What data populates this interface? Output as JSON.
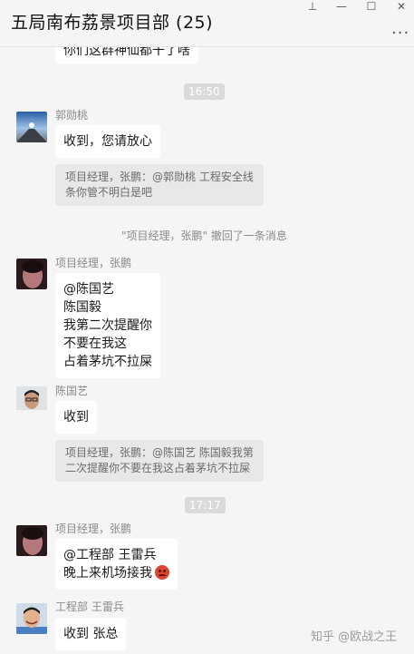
{
  "window": {
    "title": "五局南布荔景项目部 (25)",
    "pin_glyph": "⊥",
    "minimize_glyph": "—",
    "maximize_glyph": "☐",
    "close_glyph": "✕",
    "more_glyph": "···"
  },
  "messages": {
    "top_partial": "你们这群神仙都干了啥",
    "time1": "16:50",
    "msg1": {
      "sender": "郭勋桃",
      "text": "收到，您请放心"
    },
    "quote1": {
      "line1": "项目经理，张鹏：@郭勋桃 工程安全线",
      "line2": "条你管不明白是吧"
    },
    "recall_notice": "\"项目经理，张鹏\" 撤回了一条消息",
    "msg2": {
      "sender": "项目经理，张鹏",
      "lines": [
        "@陈国艺",
        "陈国毅",
        "我第二次提醒你",
        "不要在我这",
        "占着茅坑不拉屎"
      ]
    },
    "msg3": {
      "sender": "陈国艺",
      "text": "收到"
    },
    "quote2": {
      "line1": "项目经理，张鹏：@陈国艺 陈国毅我第",
      "line2": "二次提醒你不要在我这占着茅坑不拉屎"
    },
    "time2": "17:17",
    "msg4": {
      "sender": "项目经理，张鹏",
      "line1": "@工程部 王雷兵",
      "line2": "晚上来机场接我"
    },
    "msg5": {
      "sender": "工程部 王雷兵",
      "text": "收到 张总"
    }
  },
  "watermark": "知乎 @欧战之王",
  "colors": {
    "background": "#f5f5f5",
    "bubble": "#ffffff",
    "quote": "#e8e8e8",
    "time_badge": "#dadada"
  }
}
